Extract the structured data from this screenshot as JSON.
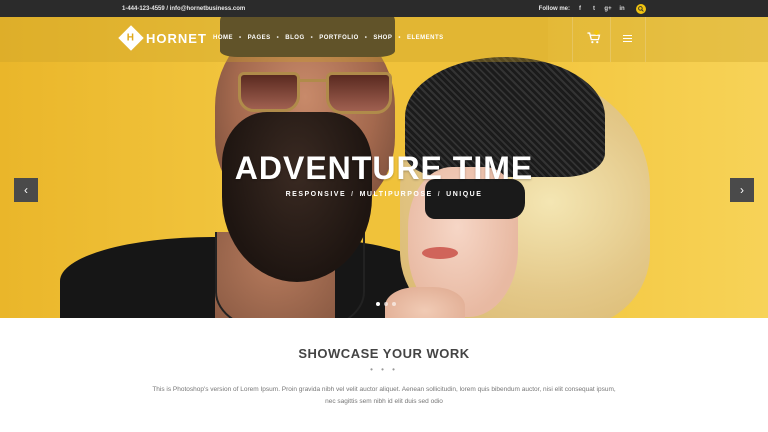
{
  "topbar": {
    "contact": "1-444-123-4559 / info@hornetbusiness.com",
    "follow_label": "Follow me:",
    "social": [
      "f",
      "t",
      "g+",
      "in"
    ]
  },
  "brand": {
    "name": "HORNET",
    "mark": "H"
  },
  "nav": {
    "items": [
      "HOME",
      "PAGES",
      "BLOG",
      "PORTFOLIO",
      "SHOP",
      "ELEMENTS"
    ],
    "separator": "•"
  },
  "hero": {
    "title": "ADVENTURE TIME",
    "subtitle_parts": [
      "RESPONSIVE",
      "MULTIPURPOSE",
      "UNIQUE"
    ],
    "subtitle_sep": "/",
    "prev_icon": "‹",
    "next_icon": "›"
  },
  "section": {
    "title": "SHOWCASE YOUR WORK",
    "divider": "• • •",
    "text": "This is Photoshop's version of Lorem Ipsum. Proin gravida nibh vel velit auctor aliquet. Aenean sollicitudin, lorem quis bibendum auctor, nisi elit consequat ipsum, nec sagittis sem nibh id elit duis sed odio"
  },
  "colors": {
    "accent": "#f1c40f",
    "topbar": "#2b2b2b",
    "hero": "#f0c23a"
  }
}
